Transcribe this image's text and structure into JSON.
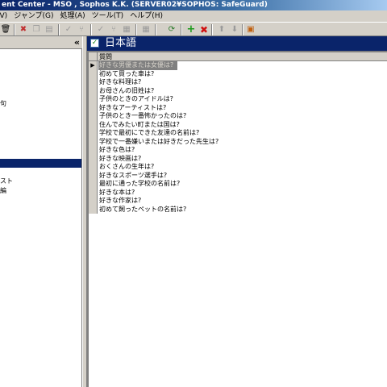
{
  "window": {
    "title": "ent Center - MSO , Sophos K.K. (SERVER02¥SOPHOS: SafeGuard)"
  },
  "menu": [
    "(V)",
    "ジャンプ(G)",
    "処理(A)",
    "ツール(T)",
    "ヘルプ(H)"
  ],
  "toolbar": {
    "icons": [
      "trash-icon",
      "delete-doc-icon",
      "copy-icon",
      "paste-icon",
      "check-icon",
      "branch-icon",
      "check2-icon",
      "tree-icon",
      "grid-icon",
      "refresh-icon",
      "add-icon",
      "remove-icon",
      "up-icon",
      "down-icon",
      "export-icon"
    ]
  },
  "left_pane": {
    "collapse_glyph": "«",
    "fragments": [
      "句",
      "スト",
      "編"
    ]
  },
  "right_pane": {
    "title": "日本語",
    "column_header": "質問",
    "questions": [
      "好きな男優または女優は?",
      "初めて買った車は?",
      "好きな料理は?",
      "お母さんの旧姓は?",
      "子供のときのアイドルは?",
      "好きなアーティストは?",
      "子供のとき一番怖かったのは?",
      "住んでみたい町または国は?",
      "学校で最初にできた友達の名前は?",
      "学校で一番嫌いまたは好きだった先生は?",
      "好きな色は?",
      "好きな映画は?",
      "おくさんの生年は?",
      "好きなスポーツ選手は?",
      "最初に通った学校の名前は?",
      "好きな本は?",
      "好きな作家は?",
      "初めて飼ったペットの名前は?"
    ],
    "selected_index": 0,
    "row_indicator": "▶"
  }
}
